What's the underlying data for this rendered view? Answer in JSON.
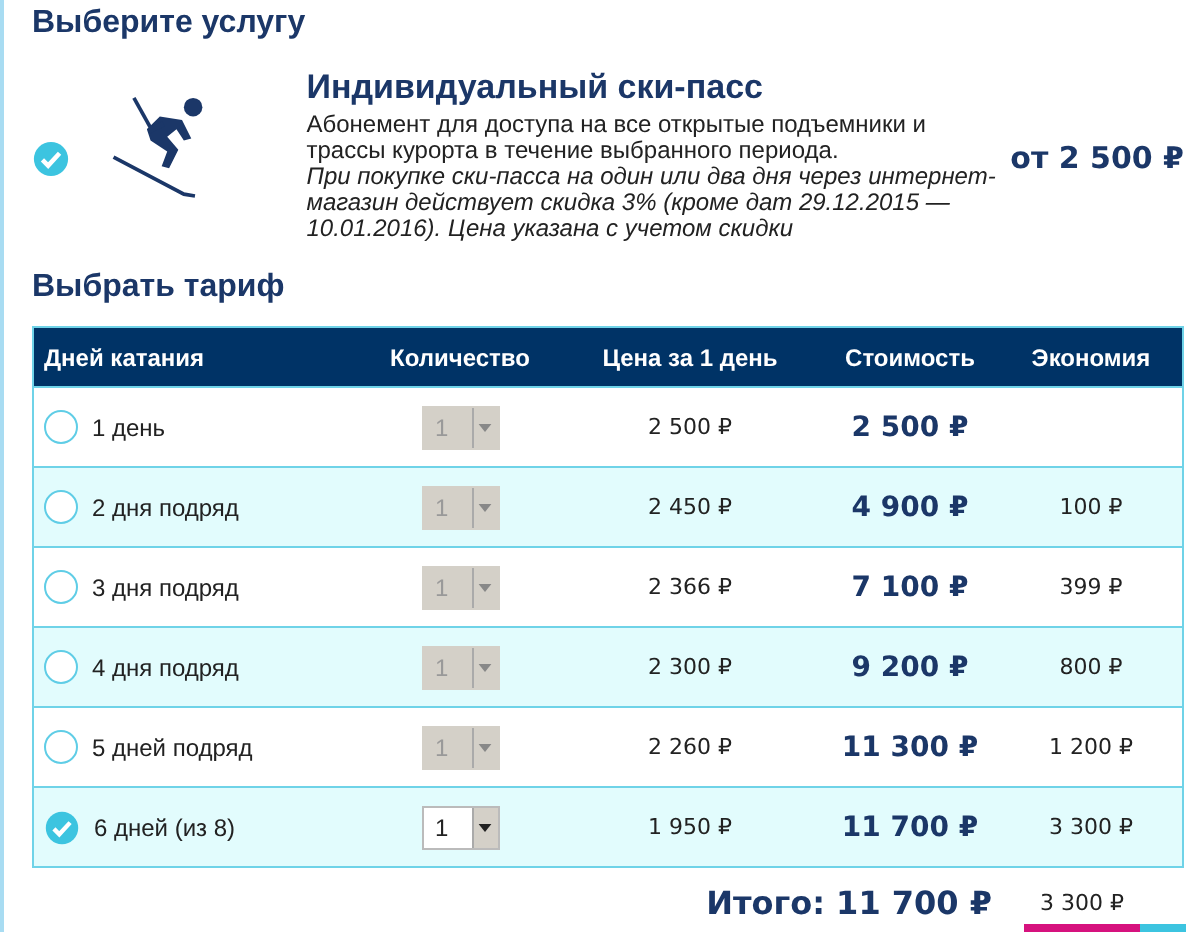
{
  "heading": "Выберите услугу",
  "service": {
    "selected": true,
    "title": "Индивидуальный ски-пасс",
    "description": "Абонемент для доступа на все открытые подъемники и трассы курорта в течение выбранного периода.",
    "note": "При покупке ски-пасса на один или два дня через интернет-магазин действует скидка 3% (кроме дат 29.12.2015 — 10.01.2016). Цена указана с учетом скидки",
    "price": "от 2 500 ₽"
  },
  "tariff_heading": "Выбрать тариф",
  "table": {
    "columns": [
      "Дней катания",
      "Количество",
      "Цена за 1 день",
      "Стоимость",
      "Экономия"
    ],
    "rows": [
      {
        "days": "1 день",
        "selected": false,
        "quantity": "1",
        "quantity_disabled": true,
        "price_per_day": "2 500 ₽",
        "cost": "2 500 ₽"
      },
      {
        "days": "2 дня подряд",
        "selected": false,
        "quantity": "1",
        "quantity_disabled": true,
        "price_per_day": "2 450 ₽",
        "cost": "4 900 ₽",
        "savings": "100 ₽"
      },
      {
        "days": "3 дня подряд",
        "selected": false,
        "quantity": "1",
        "quantity_disabled": true,
        "price_per_day": "2 366 ₽",
        "cost": "7 100 ₽",
        "savings": "399 ₽"
      },
      {
        "days": "4 дня подряд",
        "selected": false,
        "quantity": "1",
        "quantity_disabled": true,
        "price_per_day": "2 300 ₽",
        "cost": "9 200 ₽",
        "savings": "800 ₽"
      },
      {
        "days": "5 дней подряд",
        "selected": false,
        "quantity": "1",
        "quantity_disabled": true,
        "price_per_day": "2 260 ₽",
        "cost": "11 300 ₽",
        "savings": "1 200 ₽"
      },
      {
        "days": "6 дней (из 8)",
        "selected": true,
        "quantity": "1",
        "quantity_disabled": false,
        "price_per_day": "1 950 ₽",
        "cost": "11 700 ₽",
        "savings": "3 300 ₽"
      }
    ]
  },
  "total": {
    "label": "Итого: 11 700 ₽",
    "savings": "3 300 ₽"
  }
}
